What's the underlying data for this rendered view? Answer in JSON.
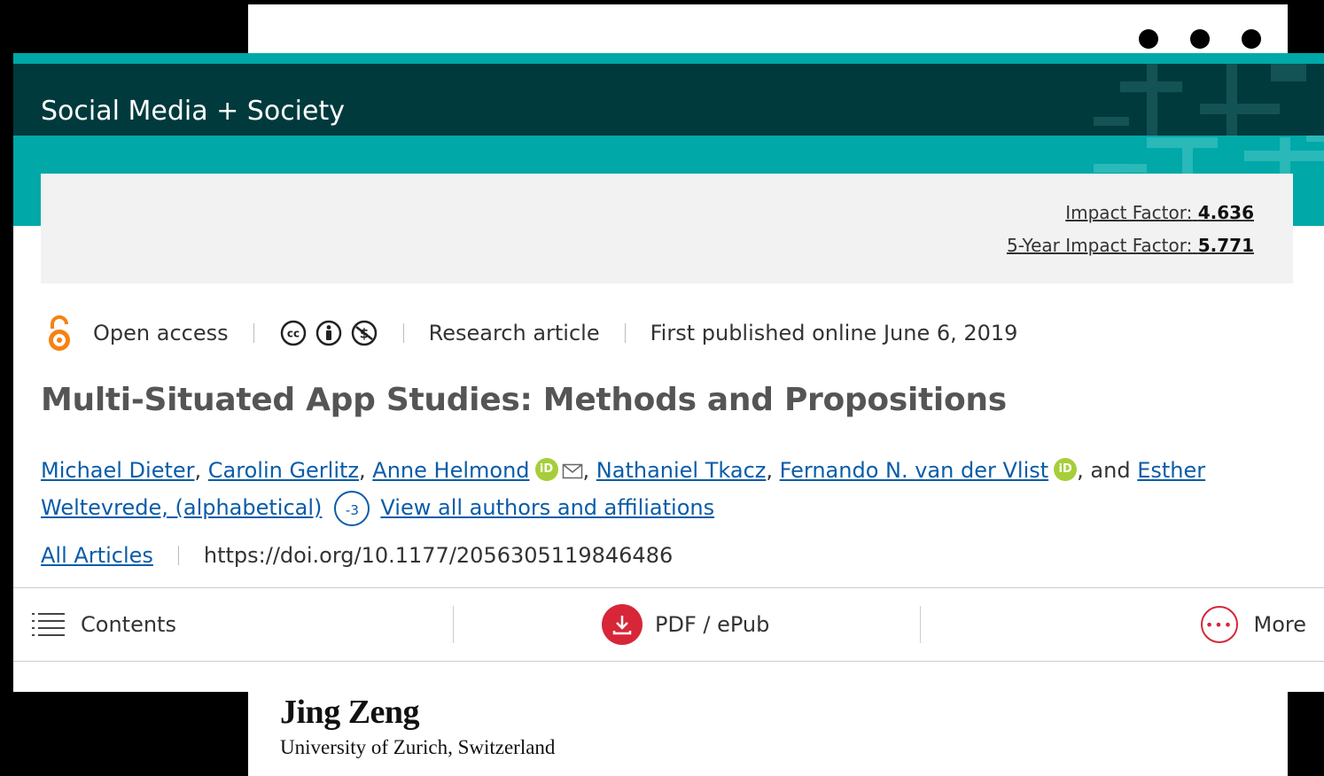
{
  "journal": {
    "title": "Social Media + Society"
  },
  "metrics": {
    "impact_factor_label": "Impact Factor:",
    "impact_factor_value": "4.636",
    "five_year_label": "5-Year Impact Factor:",
    "five_year_value": "5.771"
  },
  "meta": {
    "open_access": "Open access",
    "article_type": "Research article",
    "published": "First published online June 6, 2019",
    "license_icons": [
      "cc-icon",
      "by-icon",
      "nc-icon"
    ]
  },
  "article": {
    "title": "Multi-Situated App Studies: Methods and Propositions"
  },
  "authors": {
    "list": [
      "Michael Dieter",
      "Carolin Gerlitz",
      "Anne Helmond",
      "Nathaniel Tkacz",
      "Fernando N. van der Vlist",
      "Esther Weltevrede, (alphabetical)"
    ],
    "and_text": ", and",
    "count_badge": "-3",
    "view_all": "View all authors and affiliations"
  },
  "doi": {
    "section_link": "All Articles",
    "url": "https://doi.org/10.1177/2056305119846486"
  },
  "toolbar": {
    "contents": "Contents",
    "pdf": "PDF / ePub",
    "more": "More"
  },
  "overlay": {
    "name": "Jing Zeng",
    "affiliation": "University of Zurich, Switzerland"
  },
  "colors": {
    "teal": "#00a8a8",
    "header_dark": "#003a3d",
    "link": "#0a5ca8",
    "accent_red": "#d72638",
    "orcid_green": "#a6ce39",
    "oa_orange": "#f68212"
  }
}
